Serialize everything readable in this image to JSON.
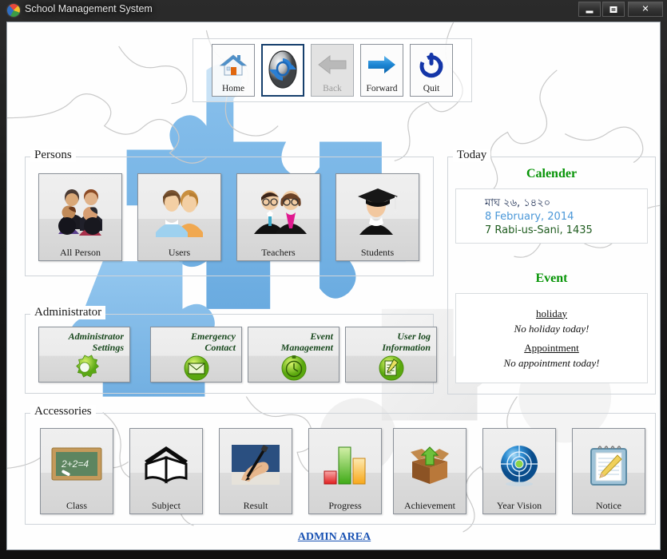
{
  "window": {
    "title": "School Management System",
    "icon": "pie-chart-icon",
    "controls": {
      "minimize": "minimize-icon",
      "maximize": "maximize-icon",
      "close": "✕"
    }
  },
  "toolbar": {
    "buttons": [
      {
        "label": "Home",
        "icon": "home-icon",
        "state": "normal"
      },
      {
        "label": "",
        "icon": "refresh-icon",
        "state": "focused"
      },
      {
        "label": "Back",
        "icon": "arrow-left-icon",
        "state": "disabled"
      },
      {
        "label": "Forward",
        "icon": "arrow-right-icon",
        "state": "normal"
      },
      {
        "label": "Quit",
        "icon": "power-icon",
        "state": "normal"
      }
    ]
  },
  "persons": {
    "legend": "Persons",
    "tiles": [
      {
        "label": "All Person",
        "icon": "group-of-people-icon"
      },
      {
        "label": "Users",
        "icon": "two-users-icon"
      },
      {
        "label": "Teachers",
        "icon": "teachers-icon"
      },
      {
        "label": "Students",
        "icon": "graduate-student-icon"
      }
    ]
  },
  "administrator": {
    "legend": "Administrator",
    "tiles": [
      {
        "line1": "Administrator",
        "line2": "Settings",
        "icon": "gear-icon"
      },
      {
        "line1": "Emergency",
        "line2": "Contact",
        "icon": "envelope-icon"
      },
      {
        "line1": "Event",
        "line2": "Management",
        "icon": "clock-icon"
      },
      {
        "line1": "User log",
        "line2": "Information",
        "icon": "notepad-pencil-icon"
      }
    ]
  },
  "accessories": {
    "legend": "Accessories",
    "tiles": [
      {
        "label": "Class",
        "icon": "chalkboard-icon",
        "icon_text": "2+2=4"
      },
      {
        "label": "Subject",
        "icon": "open-book-icon"
      },
      {
        "label": "Result",
        "icon": "writing-hand-icon"
      },
      {
        "label": "Progress",
        "icon": "bar-chart-icon"
      },
      {
        "label": "Achievement",
        "icon": "open-box-download-icon"
      },
      {
        "label": "Year Vision",
        "icon": "target-sphere-icon"
      },
      {
        "label": "Notice",
        "icon": "notepad-icon"
      }
    ]
  },
  "today": {
    "legend": "Today",
    "calendar": {
      "title": "Calender",
      "bengali_date": "মাঘ ২৬, ১৪২০",
      "gregorian_date": "8 February, 2014",
      "hijri_date": "7 Rabi-us-Sani, 1435"
    },
    "event": {
      "title": "Event",
      "holiday_heading": "holiday",
      "holiday_text": "No holiday today!",
      "appointment_heading": "Appointment",
      "appointment_text": "No appointment today!"
    }
  },
  "footer": {
    "admin_link": "ADMIN AREA"
  },
  "colors": {
    "calendar_title": "#069406",
    "gregorian": "#4a97d8",
    "hijri": "#1f5c1f",
    "bengali": "#1c2d52",
    "admin_caption": "#17471c",
    "admin_link": "#1952b3",
    "puzzle_blue": "#76b5e8"
  }
}
